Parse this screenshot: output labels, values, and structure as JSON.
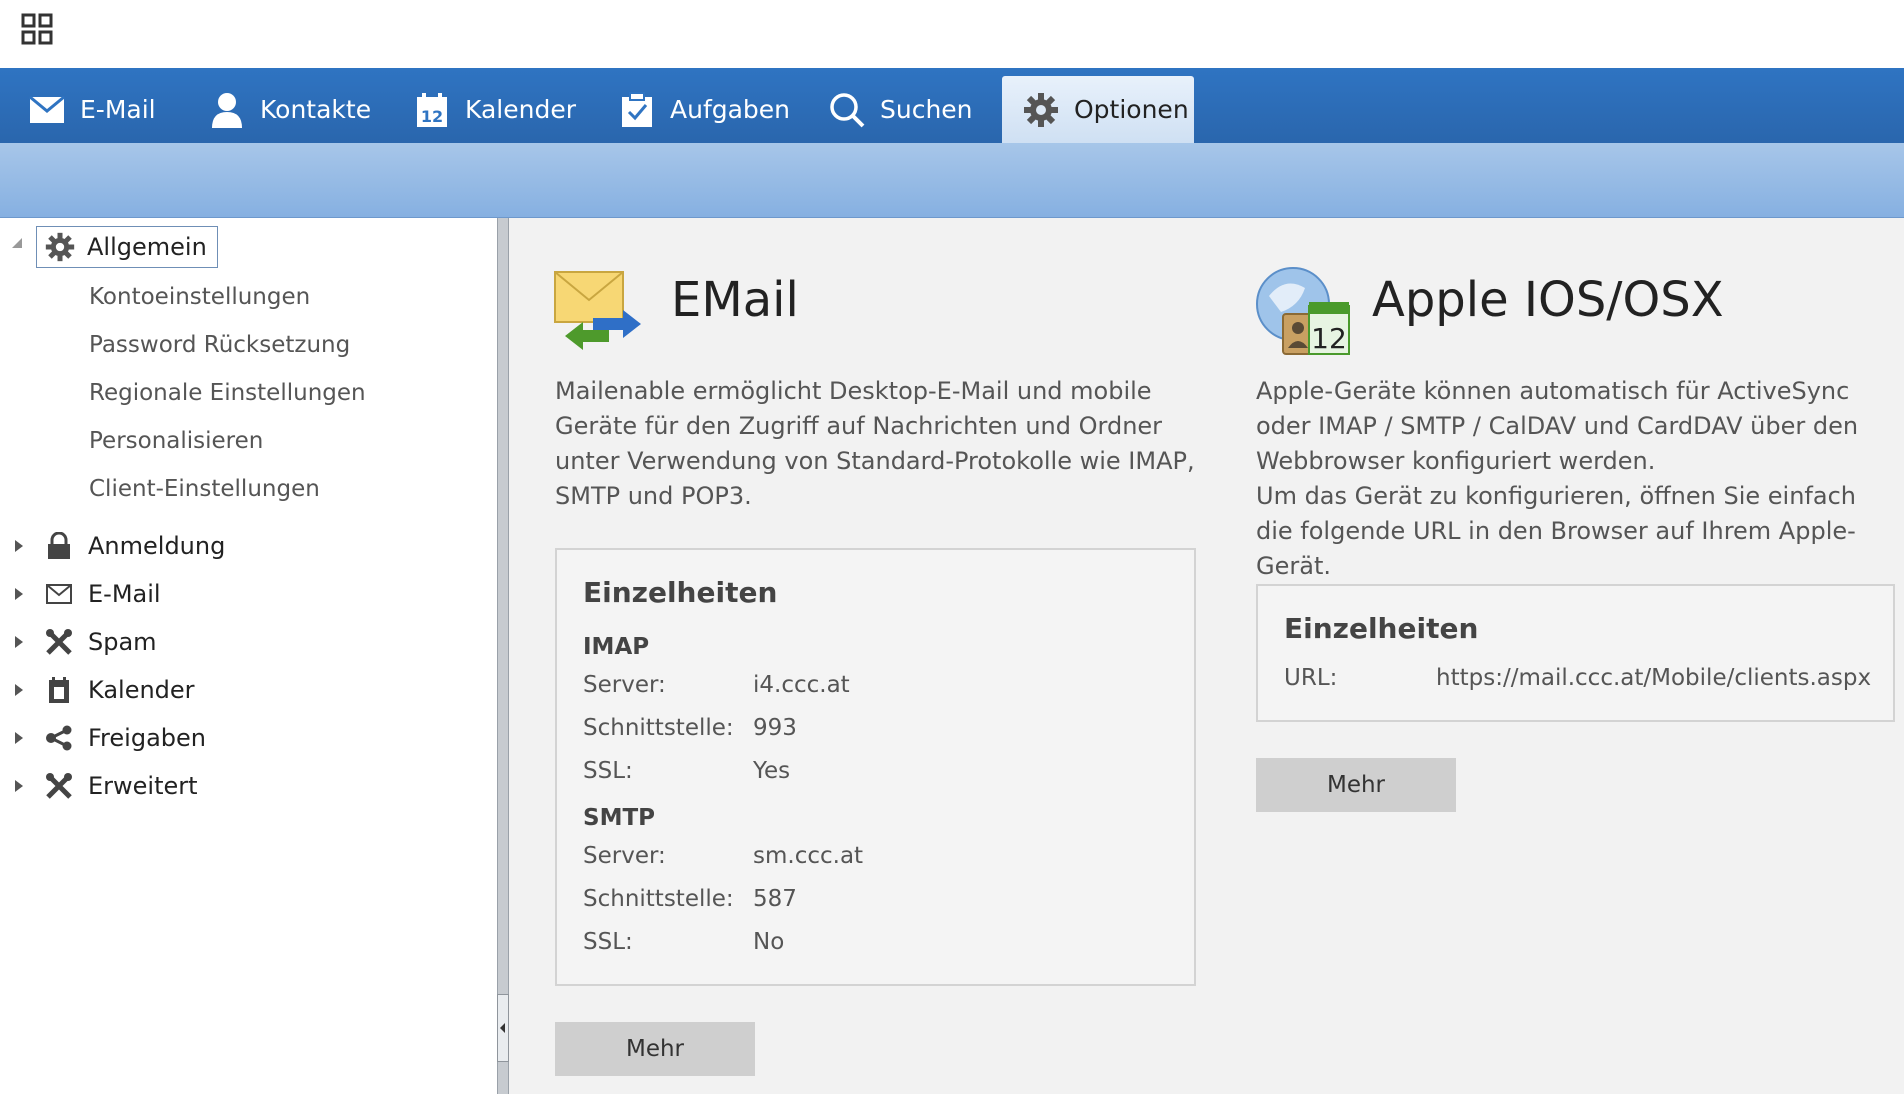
{
  "nav": {
    "tabs": [
      {
        "label": "E-Mail",
        "icon": "mail-icon"
      },
      {
        "label": "Kontakte",
        "icon": "contact-icon"
      },
      {
        "label": "Kalender",
        "icon": "calendar-icon"
      },
      {
        "label": "Aufgaben",
        "icon": "task-icon"
      },
      {
        "label": "Suchen",
        "icon": "search-icon"
      },
      {
        "label": "Optionen",
        "icon": "gear-icon",
        "active": true
      }
    ],
    "calendar_day": "12"
  },
  "sidebar": {
    "root": {
      "label": "Allgemein",
      "icon": "gear-icon"
    },
    "sub_items": [
      "Kontoeinstellungen",
      "Password Rücksetzung",
      "Regionale Einstellungen",
      "Personalisieren",
      "Client-Einstellungen"
    ],
    "items": [
      {
        "label": "Anmeldung",
        "icon": "lock-icon"
      },
      {
        "label": "E-Mail",
        "icon": "envelope-icon"
      },
      {
        "label": "Spam",
        "icon": "tools-icon"
      },
      {
        "label": "Kalender",
        "icon": "calendar-icon"
      },
      {
        "label": "Freigaben",
        "icon": "share-icon"
      },
      {
        "label": "Erweitert",
        "icon": "tools-icon"
      }
    ]
  },
  "email": {
    "title": "EMail",
    "description": "Mailenable ermöglicht Desktop-E-Mail und mobile Geräte für den Zugriff auf Nachrichten und Ordner unter Verwendung von Standard-Protokolle wie IMAP, SMTP und POP3.",
    "details_title": "Einzelheiten",
    "imap": {
      "heading": "IMAP",
      "server_label": "Server:",
      "server": "i4.ccc.at",
      "port_label": "Schnittstelle:",
      "port": "993",
      "ssl_label": "SSL:",
      "ssl": "Yes"
    },
    "smtp": {
      "heading": "SMTP",
      "server_label": "Server:",
      "server": "sm.ccc.at",
      "port_label": "Schnittstelle:",
      "port": "587",
      "ssl_label": "SSL:",
      "ssl": "No"
    },
    "more_label": "Mehr"
  },
  "apple": {
    "title": "Apple IOS/OSX",
    "icon_number": "12",
    "description_1": "Apple-Geräte können automatisch für ActiveSync oder IMAP / SMTP / CalDAV und CardDAV über den Webbrowser konfiguriert werden.",
    "description_2": "Um das Gerät zu konfigurieren, öffnen Sie einfach die folgende URL in den Browser auf Ihrem Apple-Gerät.",
    "details_title": "Einzelheiten",
    "url_label": "URL:",
    "url": "https://mail.ccc.at/Mobile/clients.aspx",
    "more_label": "Mehr"
  },
  "colors": {
    "nav_blue": "#2f74c2",
    "subbar_blue": "#94b9e5",
    "content_bg": "#f2f2f2",
    "button_grey": "#cfcfcf"
  }
}
